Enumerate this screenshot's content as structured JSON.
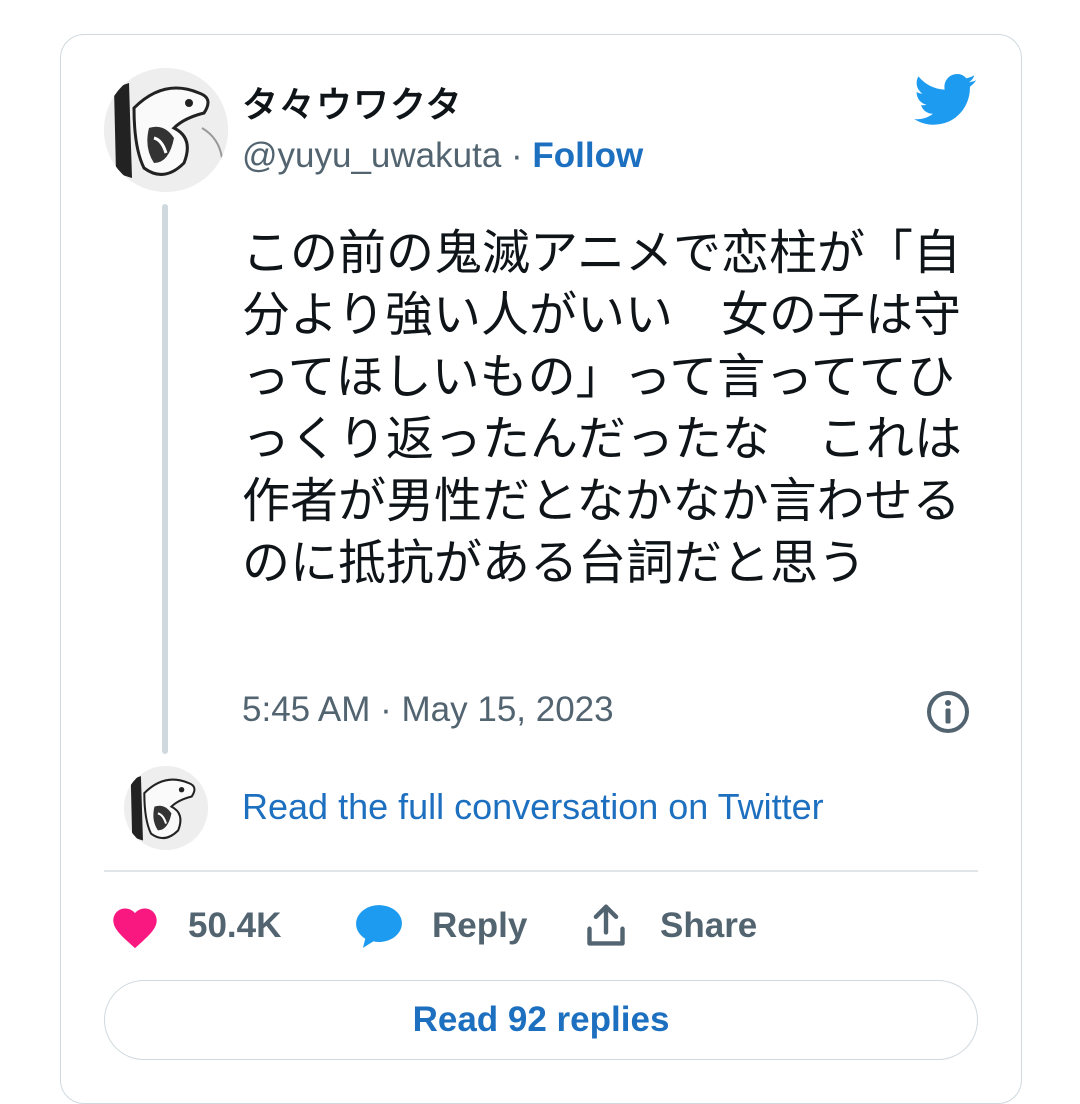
{
  "tweet": {
    "author": {
      "display_name": "タ々ウワクタ",
      "handle": "@yuyu_uwakuta",
      "follow_label": "Follow",
      "separator": "·"
    },
    "text": "この前の鬼滅アニメで恋柱が「自分より強い人がいい　女の子は守ってほしいもの」って言っててひっくり返ったんだったな　これは作者が男性だとなかなか言わせるのに抵抗がある台詞だと思う",
    "timestamp": "5:45 AM · May 15, 2023",
    "read_conversation_label": "Read the full conversation on Twitter",
    "actions": {
      "like_count": "50.4K",
      "reply_label": "Reply",
      "share_label": "Share"
    },
    "read_replies_label": "Read 92 replies"
  },
  "colors": {
    "link_blue": "#1d6fbf",
    "twitter_blue": "#1d9bf0",
    "like_pink": "#f91880",
    "secondary_text": "#536471"
  },
  "icons": [
    "avatar",
    "twitter-bird-icon",
    "info-icon",
    "heart-icon",
    "reply-bubble-icon",
    "share-icon"
  ]
}
